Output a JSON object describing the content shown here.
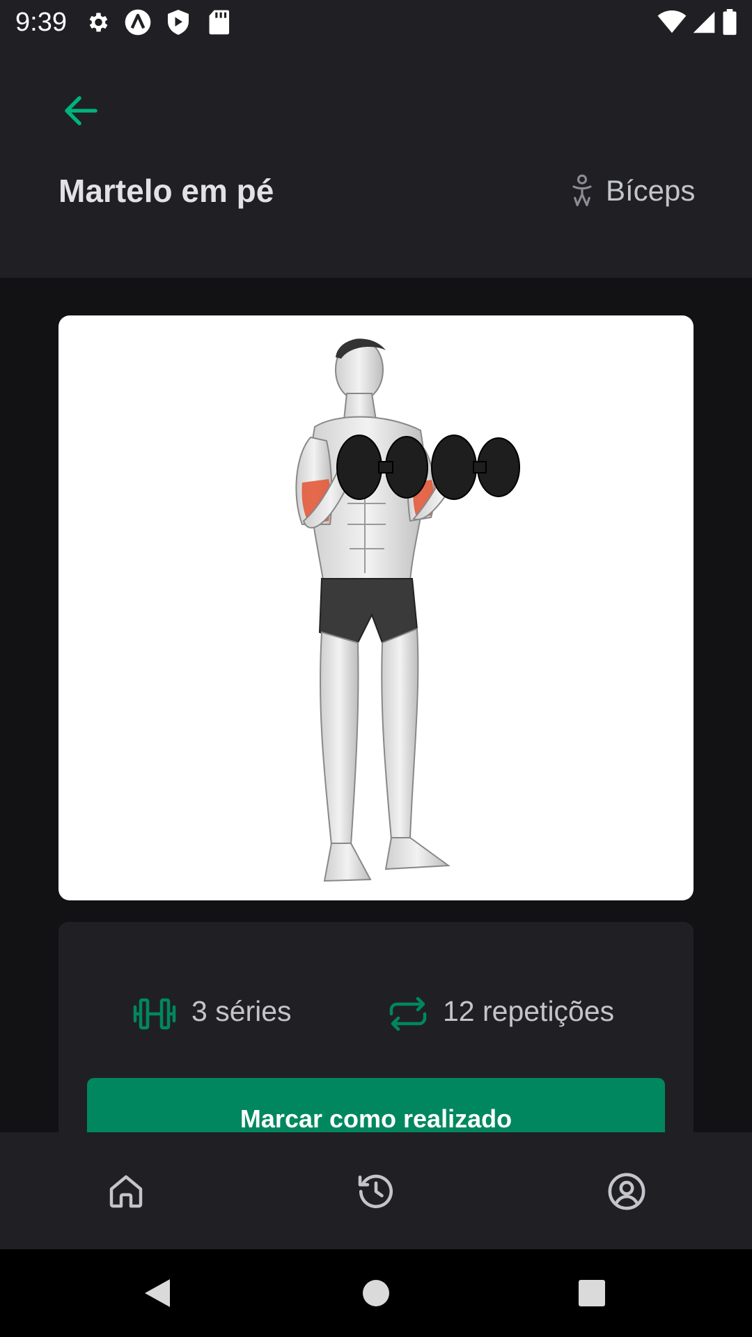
{
  "status_bar": {
    "time": "9:39",
    "left_icons": [
      "settings-gear-icon",
      "a-circle-icon",
      "shield-play-icon",
      "sd-card-icon"
    ],
    "right_icons": [
      "wifi-icon",
      "cell-signal-icon",
      "battery-icon"
    ]
  },
  "header": {
    "back_icon": "arrow-left-icon",
    "title": "Martelo em pé",
    "muscle_group": "Bíceps",
    "muscle_icon": "body-person-icon"
  },
  "exercise": {
    "image_description_icon": "hammer-curl-illustration",
    "series_text": "3 séries",
    "reps_text": "12 repetições",
    "series_icon": "barbell-icon",
    "reps_icon": "repeat-icon",
    "mark_done_label": "Marcar como realizado"
  },
  "tab_bar": {
    "items": [
      {
        "icon": "home-icon"
      },
      {
        "icon": "history-icon"
      },
      {
        "icon": "profile-icon"
      }
    ]
  },
  "system_nav": {
    "buttons": [
      "back-triangle-icon",
      "home-circle-icon",
      "recents-square-icon"
    ]
  },
  "colors": {
    "background": "#121214",
    "surface": "#202024",
    "accent": "#00875F",
    "accent_light": "#00B37E",
    "text": "#E1E1E6",
    "muscle_highlight": "#E25A3B"
  }
}
